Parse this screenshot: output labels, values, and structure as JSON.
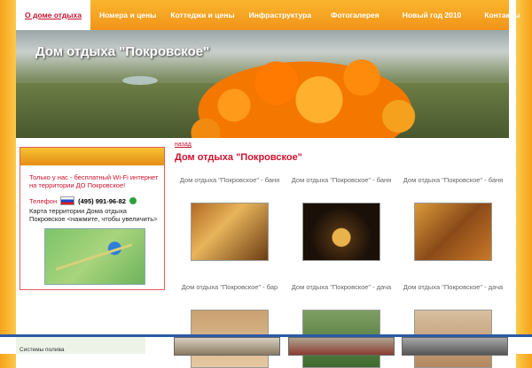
{
  "nav": {
    "items": [
      {
        "label": "О доме отдыха",
        "active": true
      },
      {
        "label": "Номера и цены",
        "active": false
      },
      {
        "label": "Коттеджи и цены",
        "active": false
      },
      {
        "label": "Инфраструктура",
        "active": false
      },
      {
        "label": "Фотогалерея",
        "active": false
      },
      {
        "label": "Новый год 2010",
        "active": false
      },
      {
        "label": "Контакты",
        "active": false
      }
    ]
  },
  "banner": {
    "title": "Дом отдыха \"Покровское\""
  },
  "sidebar": {
    "wifi_text": "Только у нас - бесплатный Wi-Fi интернет на территории ДО Покровское!",
    "phone_label": "Телефон",
    "phone_number": "(495) 991-96-82",
    "map_text": "Карта территории Дома отдыха Покровское <нажмите, чтобы увеличить>"
  },
  "main": {
    "back_link": "назад",
    "title": "Дом отдыха \"Покровское\"",
    "gallery": [
      {
        "caption": "Дом отдыха \"Покровское\" - баня"
      },
      {
        "caption": "Дом отдыха \"Покровское\" - баня"
      },
      {
        "caption": "Дом отдыха \"Покровское\" - баня"
      },
      {
        "caption": "Дом отдыха \"Покровское\" - бар"
      },
      {
        "caption": "Дом отдыха \"Покровское\" - дача"
      },
      {
        "caption": "Дом отдыха \"Покровское\" - дача"
      }
    ]
  },
  "bottom": {
    "label": "Системы полива"
  },
  "colors": {
    "accent": "#f7a21a",
    "title_red": "#d2122e",
    "link_red": "#c8102e"
  }
}
